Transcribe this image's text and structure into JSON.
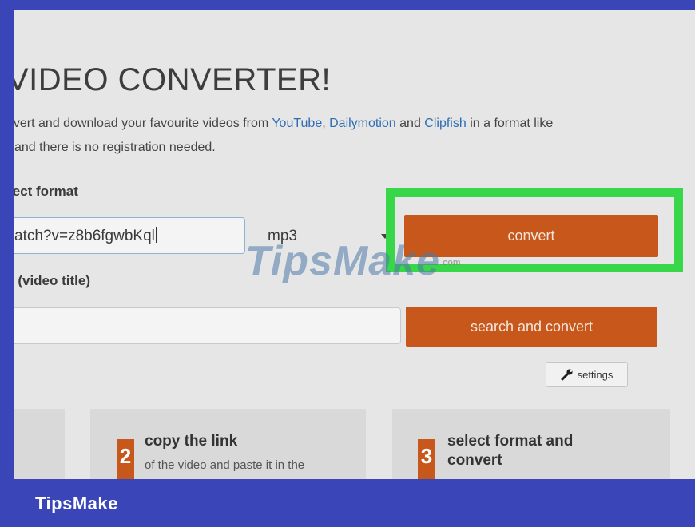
{
  "page": {
    "heading": "VIDEO CONVERTER!",
    "intro": {
      "line1_prefix": "nvert and download your favourite videos from ",
      "link_youtube": "YouTube",
      "sep1": ", ",
      "link_dailymotion": "Dailymotion",
      "sep2": " and ",
      "link_clipfish": "Clipfish",
      "line1_suffix": " in a format like",
      "line2": "and there is no registration needed."
    }
  },
  "form": {
    "format_label": "lect format",
    "url_value": "atch?v=z8b6fgwbKql",
    "format_selected": "mp3",
    "convert_label": "convert",
    "title_label": "r (video title)",
    "title_value": "",
    "search_convert_label": "search and convert",
    "settings_label": "settings"
  },
  "steps": [
    {
      "number": "2",
      "title": "copy the link",
      "text": "of the video and paste it in the"
    },
    {
      "number": "3",
      "title": "select format and convert",
      "text": ""
    }
  ],
  "watermark": {
    "text": "TipsMake",
    "suffix": ".com"
  },
  "footer": {
    "brand": "TipsMake"
  },
  "colors": {
    "frame": "#3a46b8",
    "button": "#c7571a",
    "highlight": "#38d74a",
    "link": "#2e6db4"
  },
  "icons": {
    "settings": "wrench-icon",
    "dropdown": "chevron-down-icon"
  }
}
